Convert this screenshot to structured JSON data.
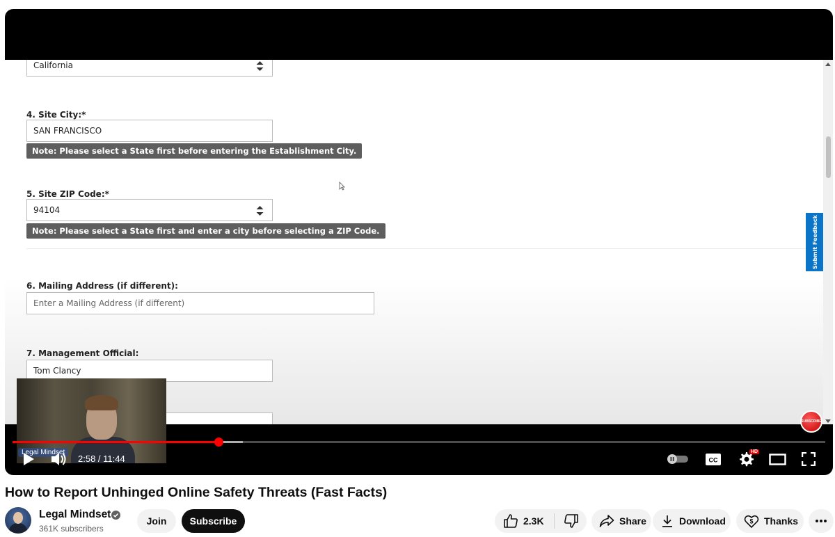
{
  "video": {
    "title": "How to Report Unhinged Online Safety Threats (Fast Facts)",
    "time_current": "2:58",
    "time_total": "11:44",
    "time_display": "2:58 / 11:44",
    "progress_fraction": 0.253,
    "buffered_fraction": 0.283,
    "subscribe_watermark": "SUBSCRIBE",
    "settings_badge": "HD",
    "cam_label": "Legal Mindset"
  },
  "form": {
    "state_value": "California",
    "city_label": "4. Site City:*",
    "city_value": "SAN FRANCISCO",
    "city_note": "Note: Please select a State first before entering the Establishment City.",
    "zip_label": "5. Site ZIP Code:*",
    "zip_value": "94104",
    "zip_note": "Note: Please select a State first and enter a city before selecting a ZIP Code.",
    "mailing_label": "6. Mailing Address (if different):",
    "mailing_placeholder": "Enter a Mailing Address (if different)",
    "official_label": "7. Management Official:",
    "official_value": "Tom Clancy",
    "feedback_tab": "Submit Feedback"
  },
  "channel": {
    "name": "Legal Mindset",
    "subscribers": "361K subscribers",
    "join_label": "Join",
    "subscribe_label": "Subscribe"
  },
  "actions": {
    "likes": "2.3K",
    "share_label": "Share",
    "download_label": "Download",
    "thanks_label": "Thanks"
  },
  "colors": {
    "progress": "#ff0000",
    "note_bg": "#5e5e5e",
    "feedback_tab": "#0b74c7",
    "subscribe_bg": "#0f0f0f"
  },
  "icons": [
    "play-icon",
    "volume-icon",
    "autoplay-toggle-icon",
    "captions-icon",
    "settings-icon",
    "theater-icon",
    "fullscreen-icon",
    "like-icon",
    "dislike-icon",
    "share-icon",
    "download-icon",
    "thanks-icon",
    "more-icon",
    "verified-icon"
  ]
}
